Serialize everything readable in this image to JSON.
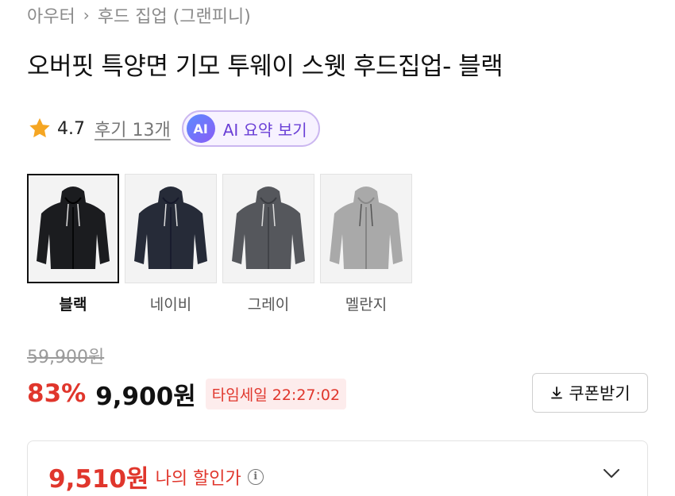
{
  "breadcrumb": {
    "items": [
      "아우터",
      "후드 집업 (그랜피니)"
    ]
  },
  "product": {
    "title": "오버핏 특양면 기모 투웨이 스웻 후드집업- 블랙",
    "rating": "4.7",
    "reviews_label": "후기 13개",
    "ai_badge": "AI",
    "ai_summary_label": "AI 요약 보기"
  },
  "colors": [
    {
      "name": "블랙",
      "selected": true,
      "hex": "#1b1c1f"
    },
    {
      "name": "네이비",
      "selected": false,
      "hex": "#262b38"
    },
    {
      "name": "그레이",
      "selected": false,
      "hex": "#55575c"
    },
    {
      "name": "멜란지",
      "selected": false,
      "hex": "#a9a9a9"
    }
  ],
  "pricing": {
    "original_price": "59,900원",
    "discount_rate": "83%",
    "sale_price": "9,900원",
    "timer_text": "타임세일 22:27:02",
    "coupon_label": "쿠폰받기",
    "my_price": "9,510원",
    "my_price_label": "나의 할인가"
  },
  "theme": {
    "accent_red": "#e0362c",
    "ai_purple": "#6a3fd6",
    "star_orange": "#f5a623"
  }
}
